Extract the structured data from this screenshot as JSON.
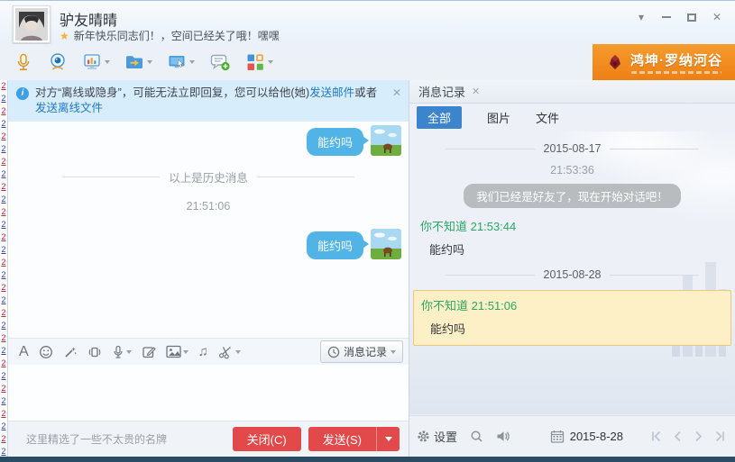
{
  "background": {
    "edge_char": "2"
  },
  "titlebar": {
    "name": "驴友晴晴",
    "signature": "新年快乐同志们！，空间已经关了哦！嘿嘿",
    "star_glyph": "★",
    "menu_glyph": "▾",
    "close_glyph": "✕"
  },
  "ad": {
    "brand": "鸿坤·罗纳河谷"
  },
  "notice": {
    "prefix": "对方“离线或隐身”，可能无法立即回复，您可以给他(她)",
    "mail_link": "发送邮件",
    "conjunction": "或者",
    "offline_file_link": "发送离线文件",
    "close_glyph": "✕",
    "info_glyph": "i"
  },
  "chat": {
    "messages": [
      {
        "text": "能约吗"
      },
      {
        "text": "能约吗"
      }
    ],
    "history_divider": "以上是历史消息",
    "time": "21:51:06"
  },
  "editor": {
    "font_glyph": "A",
    "music_glyph": "♫",
    "history_button": "消息记录"
  },
  "footer": {
    "hint": "这里精选了一些不太贵的名牌",
    "close_button": "关闭(C)",
    "send_button": "发送(S)"
  },
  "history_panel": {
    "tab": "消息记录",
    "tab_close_glyph": "✕",
    "filters": {
      "all": "全部",
      "images": "图片",
      "files": "文件"
    },
    "date_divider_1": "2015-08-17",
    "time_1": "21:53:36",
    "system_message": "我们已经是好友了，现在开始对话吧！",
    "entry_1": {
      "name": "你不知道",
      "time": "21:53:44",
      "text": "能约吗"
    },
    "date_divider_2": "2015-08-28",
    "entry_2": {
      "name": "你不知道",
      "time": "21:51:06",
      "text": "能约吗"
    },
    "bottom": {
      "settings": "设置",
      "date": "2015-8-28"
    }
  },
  "colors": {
    "accent_blue": "#3c85cc",
    "bubble_blue": "#52b3e7",
    "link_blue": "#1f78c8",
    "name_green": "#2aa765",
    "highlight_bg": "#fdf0c6",
    "highlight_border": "#e9c87e",
    "button_red": "#e2494b",
    "ad_orange": "#ee8014",
    "bottom_strip": "#2b4d63"
  }
}
